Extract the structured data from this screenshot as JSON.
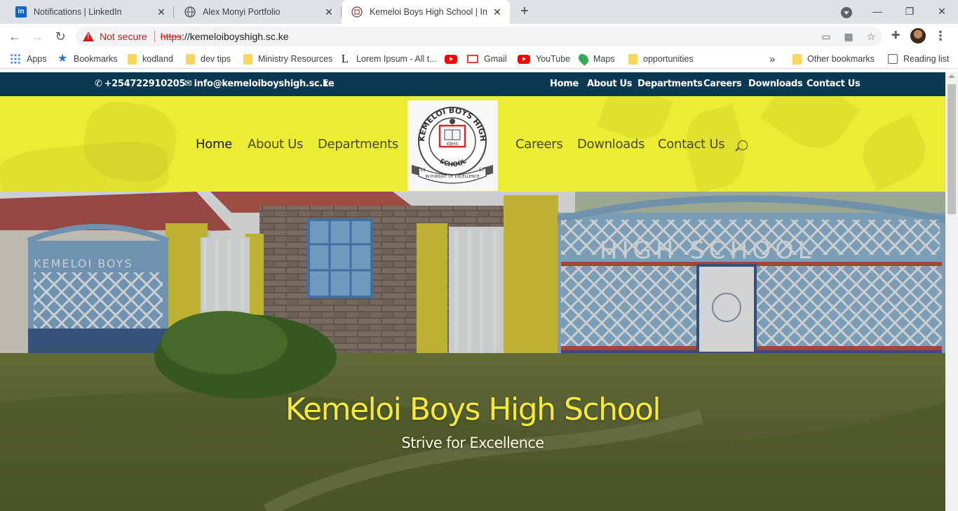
{
  "browser": {
    "tabs": [
      {
        "title": "Notifications | LinkedIn",
        "icon": "linkedin-icon"
      },
      {
        "title": "Alex Monyi Portfolio",
        "icon": "globe-icon"
      },
      {
        "title": "Kemeloi Boys High School | In Pu",
        "icon": "school-crest-icon",
        "active": true
      }
    ],
    "new_tab": "+",
    "address": {
      "security_label": "Not secure",
      "scheme": "https",
      "rest": "://kemeloiboyshigh.sc.ke"
    },
    "bookmarks": [
      {
        "label": "Apps",
        "icon": "apps-grid-icon"
      },
      {
        "label": "Bookmarks",
        "icon": "star-icon"
      },
      {
        "label": "kodland",
        "icon": "folder-icon"
      },
      {
        "label": "dev tips",
        "icon": "folder-icon"
      },
      {
        "label": "Ministry Resources",
        "icon": "folder-icon"
      },
      {
        "label": "Lorem Ipsum - All t...",
        "icon": "lorem-icon"
      },
      {
        "label": "",
        "icon": "youtube-icon"
      },
      {
        "label": "Gmail",
        "icon": "gmail-icon"
      },
      {
        "label": "YouTube",
        "icon": "youtube-icon"
      },
      {
        "label": "Maps",
        "icon": "maps-icon"
      },
      {
        "label": "opportunities",
        "icon": "folder-icon"
      }
    ],
    "more_bookmarks": "»",
    "other_bookmarks": "Other bookmarks",
    "reading_list": "Reading list"
  },
  "site": {
    "topbar": {
      "phone": "+254722910205",
      "email": "info@kemeloiboyshigh.sc.ke",
      "social": "f",
      "nav": [
        "Home",
        "About Us",
        "Departments",
        "Careers",
        "Downloads",
        "Contact Us"
      ]
    },
    "mainnav": {
      "left": [
        "Home",
        "About Us",
        "Departments"
      ],
      "right": [
        "Careers",
        "Downloads",
        "Contact Us"
      ],
      "current": "Home"
    },
    "logo": {
      "arc_text": "KEMELOI BOYS HIGH",
      "bottom_text": "SCHOOL",
      "initials": "KBHS",
      "year_left": "19",
      "year_right": "57",
      "motto": "IN PURSUIT OF EXCELLENCE"
    },
    "hero": {
      "title": "Kemeloi Boys High School",
      "subtitle": "Strive for Excellence",
      "gate_text_left": "KEMELOI BOYS",
      "gate_text_right": "HIGH   SCHOOL"
    }
  },
  "colors": {
    "topbar_bg": "#0b3954",
    "header_bg": "#ecec35",
    "hero_title": "#f6e93a"
  }
}
